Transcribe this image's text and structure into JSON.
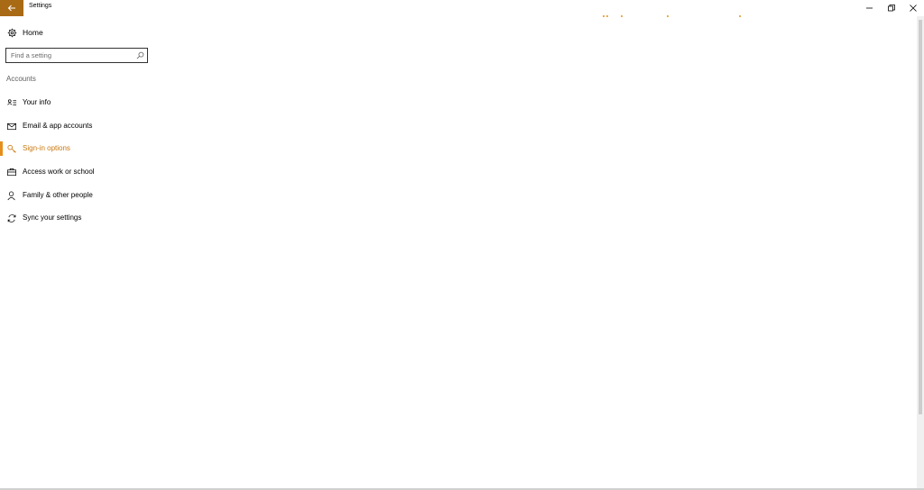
{
  "window": {
    "title": "Settings",
    "accent_color": "#a96a16",
    "back_icon": "arrow-left-icon",
    "caption_buttons": [
      "minimize-icon",
      "restore-icon",
      "close-icon"
    ]
  },
  "nav": {
    "home_label": "Home",
    "home_icon": "gear-icon",
    "search": {
      "placeholder": "Find a setting",
      "value": "",
      "icon": "search-icon"
    },
    "section_title": "Accounts",
    "items": [
      {
        "label": "Your info",
        "icon": "person-card-icon",
        "selected": false
      },
      {
        "label": "Email & app accounts",
        "icon": "mail-icon",
        "selected": false
      },
      {
        "label": "Sign-in options",
        "icon": "key-icon",
        "selected": true
      },
      {
        "label": "Access work or school",
        "icon": "briefcase-icon",
        "selected": false
      },
      {
        "label": "Family & other people",
        "icon": "person-icon",
        "selected": false
      },
      {
        "label": "Sync your settings",
        "icon": "sync-icon",
        "selected": false
      }
    ],
    "selected_color": "#c9780f"
  }
}
